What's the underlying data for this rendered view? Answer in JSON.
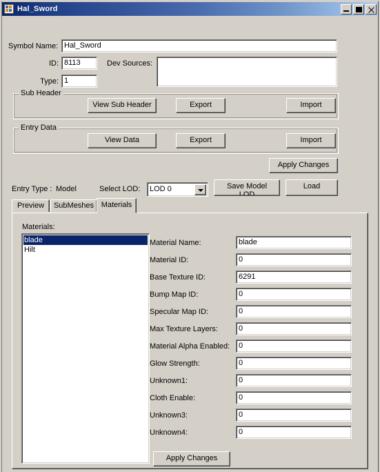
{
  "window": {
    "title": "Hal_Sword",
    "icon": "app-winforms-icon",
    "controls": {
      "minimize": "minimize-icon",
      "maximize": "maximize-icon",
      "close": "close-icon"
    },
    "colors": {
      "face": "#d4d0c8",
      "title_start": "#0a246a",
      "title_end": "#b0cdf0",
      "selection": "#0a246a",
      "field": "#ffffff"
    }
  },
  "form": {
    "symbol_name_label": "Symbol Name:",
    "symbol_name_value": "Hal_Sword",
    "id_label": "ID:",
    "id_value": "8113",
    "type_label": "Type:",
    "type_value": "1",
    "dev_sources_label": "Dev Sources:",
    "dev_sources_value": ""
  },
  "sub_header_group": {
    "title": "Sub Header",
    "view_label": "View Sub Header",
    "export_label": "Export",
    "import_label": "Import"
  },
  "entry_data_group": {
    "title": "Entry Data",
    "view_label": "View Data",
    "export_label": "Export",
    "import_label": "Import"
  },
  "apply_changes_top_label": "Apply Changes",
  "entry_row": {
    "entry_type_label": "Entry Type :",
    "entry_type_value": "Model",
    "select_lod_label": "Select LOD:",
    "lod_selected": "LOD 0",
    "lod_options": [
      "LOD 0"
    ],
    "save_model_lod_line1": "Save Model",
    "save_model_lod_line2": "LOD",
    "load_label": "Load"
  },
  "tabs": [
    {
      "label": "Preview",
      "active": false
    },
    {
      "label": "SubMeshes",
      "active": false
    },
    {
      "label": "Materials",
      "active": true
    }
  ],
  "materials_tab": {
    "list_label": "Materials:",
    "list_items": [
      {
        "name": "blade",
        "selected": true
      },
      {
        "name": "Hilt",
        "selected": false
      }
    ],
    "properties": [
      {
        "label": "Material Name:",
        "value": "blade"
      },
      {
        "label": "Material ID:",
        "value": "0"
      },
      {
        "label": "Base Texture ID:",
        "value": "6291"
      },
      {
        "label": "Bump Map ID:",
        "value": "0"
      },
      {
        "label": "Specular Map ID:",
        "value": "0"
      },
      {
        "label": "Max Texture Layers:",
        "value": "0"
      },
      {
        "label": "Material Alpha Enabled:",
        "value": "0"
      },
      {
        "label": "Glow Strength:",
        "value": "0"
      },
      {
        "label": "Unknown1:",
        "value": "0"
      },
      {
        "label": "Cloth Enable:",
        "value": "0"
      },
      {
        "label": "Unknown3:",
        "value": "0"
      },
      {
        "label": "Unknown4:",
        "value": "0"
      }
    ],
    "apply_changes_label": "Apply Changes"
  }
}
